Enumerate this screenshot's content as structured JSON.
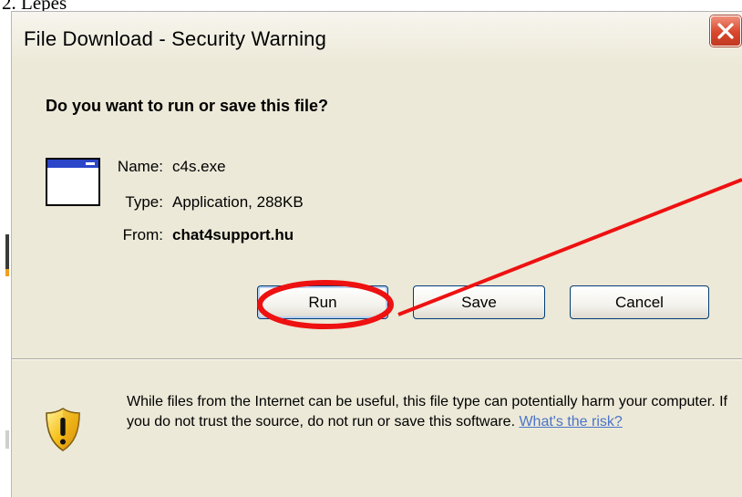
{
  "document": {
    "step_label": "2. Lépés"
  },
  "dialog": {
    "title": "File Download - Security Warning",
    "question": "Do you want to run or save this file?",
    "file": {
      "name_label": "Name:",
      "name_value": "c4s.exe",
      "type_label": "Type:",
      "type_value": "Application, 288KB",
      "from_label": "From:",
      "from_value": "chat4support.hu"
    },
    "buttons": {
      "run": "Run",
      "save": "Save",
      "cancel": "Cancel"
    },
    "warning": {
      "text": "While files from the Internet can be useful, this file type can potentially harm your computer. If you do not trust the source, do not run or save this software. ",
      "link": "What's the risk?"
    }
  },
  "colors": {
    "dialog_bg": "#ece9d8",
    "close_red": "#d9462c",
    "annotation_red": "#ee1111",
    "link_blue": "#4b74c8"
  },
  "icons": {
    "close": "close-icon",
    "file": "application-window-icon",
    "warning": "security-shield-icon"
  },
  "annotation": {
    "highlight_target": "Run"
  }
}
